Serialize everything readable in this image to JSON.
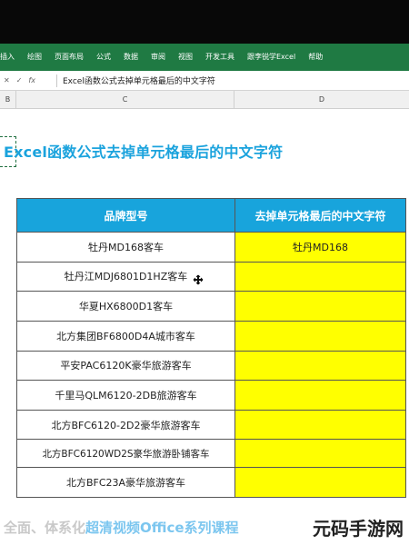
{
  "ribbon": {
    "tabs": [
      "插入",
      "绘图",
      "页面布局",
      "公式",
      "数据",
      "审阅",
      "视图",
      "开发工具",
      "跟李锐学Excel",
      "帮助"
    ]
  },
  "formula_bar": {
    "cancel_glyph": "✕",
    "confirm_glyph": "✓",
    "fx_label": "fx",
    "formula": "Excel函数公式去掉单元格最后的中文字符"
  },
  "columns": [
    "B",
    "C",
    "D"
  ],
  "sheet": {
    "title": "Excel函数公式去掉单元格最后的中文字符",
    "headers": [
      "品牌型号",
      "去掉单元格最后的中文字符"
    ],
    "rows": [
      {
        "model": "牡丹MD168客车",
        "result": "牡丹MD168"
      },
      {
        "model": "牡丹江MDJ6801D1HZ客车",
        "result": ""
      },
      {
        "model": "华夏HX6800D1客车",
        "result": ""
      },
      {
        "model": "北方集团BF6800D4A城市客车",
        "result": ""
      },
      {
        "model": "平安PAC6120K豪华旅游客车",
        "result": ""
      },
      {
        "model": "千里马QLM6120-2DB旅游客车",
        "result": ""
      },
      {
        "model": "北方BFC6120-2D2豪华旅游客车",
        "result": ""
      },
      {
        "model": "北方BFC6120WD2S豪华旅游卧铺客车",
        "result": ""
      },
      {
        "model": "北方BFC23A豪华旅游客车",
        "result": ""
      }
    ]
  },
  "footer": {
    "part1": "全面、体系化",
    "part2": "超清视频Office系列课程"
  },
  "watermark": "元码手游网",
  "colors": {
    "ribbon": "#1f7a43",
    "header": "#18a4dc",
    "highlight": "#ffff00",
    "title": "#1ba3dd"
  }
}
